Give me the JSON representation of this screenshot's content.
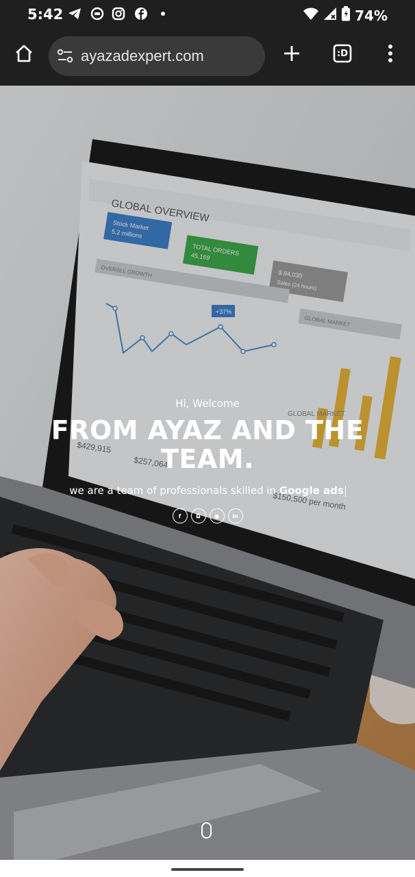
{
  "status_bar": {
    "time": "5:42",
    "battery": "74%",
    "notification_icons": [
      "telegram-icon",
      "messenger-icon",
      "instagram-icon",
      "facebook-icon",
      "dot-icon"
    ]
  },
  "browser": {
    "url": "ayazadexpert.com",
    "tab_switcher_label": ":D"
  },
  "hero": {
    "welcome": "Hi, Welcome",
    "headline": "FROM AYAZ AND THE TEAM.",
    "tagline_prefix": "we are a team of professionals skilled in ",
    "tagline_highlight": "Google ads",
    "social_links": [
      {
        "icon": "facebook-icon",
        "label": "f"
      },
      {
        "icon": "instagram-icon",
        "label": "◘"
      },
      {
        "icon": "camera-icon",
        "label": "●"
      },
      {
        "icon": "linkedin-icon",
        "label": "in"
      }
    ]
  },
  "laptop_screen": {
    "title": "GLOBAL OVERVIEW",
    "cards": [
      {
        "label": "Stock Market",
        "value": "5.2 millions",
        "color": "#3d7fc7"
      },
      {
        "label": "TOTAL ORDERS",
        "value": "45,169",
        "color": "#3fa84a"
      },
      {
        "label": "$ 84,030",
        "value": "Sales (24 hours)",
        "color": "#9a9a9a"
      }
    ],
    "panels": [
      "OVERALL GROWTH",
      "GLOBAL MARKET"
    ],
    "badge": "+37%",
    "stats": [
      "$429,915",
      "$257,064",
      "$150,500 per month"
    ]
  },
  "colors": {
    "system_bar": "#1f1f1f",
    "url_field": "#3a3a3a",
    "accent_green": "#3fa84a",
    "accent_blue": "#3d7fc7",
    "chart_bar": "#e6b33a"
  }
}
